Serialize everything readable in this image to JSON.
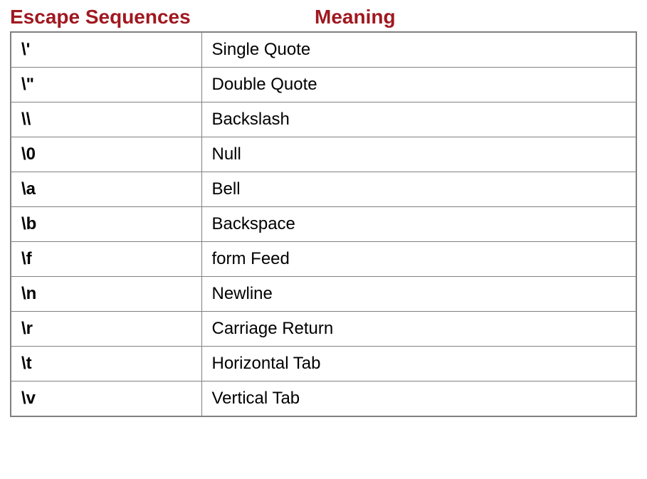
{
  "headers": {
    "sequences": "Escape Sequences",
    "meaning": "Meaning"
  },
  "rows": [
    {
      "sequence": "\\'",
      "meaning": "Single Quote"
    },
    {
      "sequence": "\\\"",
      "meaning": "Double Quote"
    },
    {
      "sequence": "\\\\",
      "meaning": "Backslash"
    },
    {
      "sequence": "\\0",
      "meaning": "Null"
    },
    {
      "sequence": "\\a",
      "meaning": "Bell"
    },
    {
      "sequence": "\\b",
      "meaning": "Backspace"
    },
    {
      "sequence": "\\f",
      "meaning": "form Feed"
    },
    {
      "sequence": "\\n",
      "meaning": "Newline"
    },
    {
      "sequence": "\\r",
      "meaning": "Carriage Return"
    },
    {
      "sequence": "\\t",
      "meaning": "Horizontal Tab"
    },
    {
      "sequence": "\\v",
      "meaning": "Vertical Tab"
    }
  ]
}
